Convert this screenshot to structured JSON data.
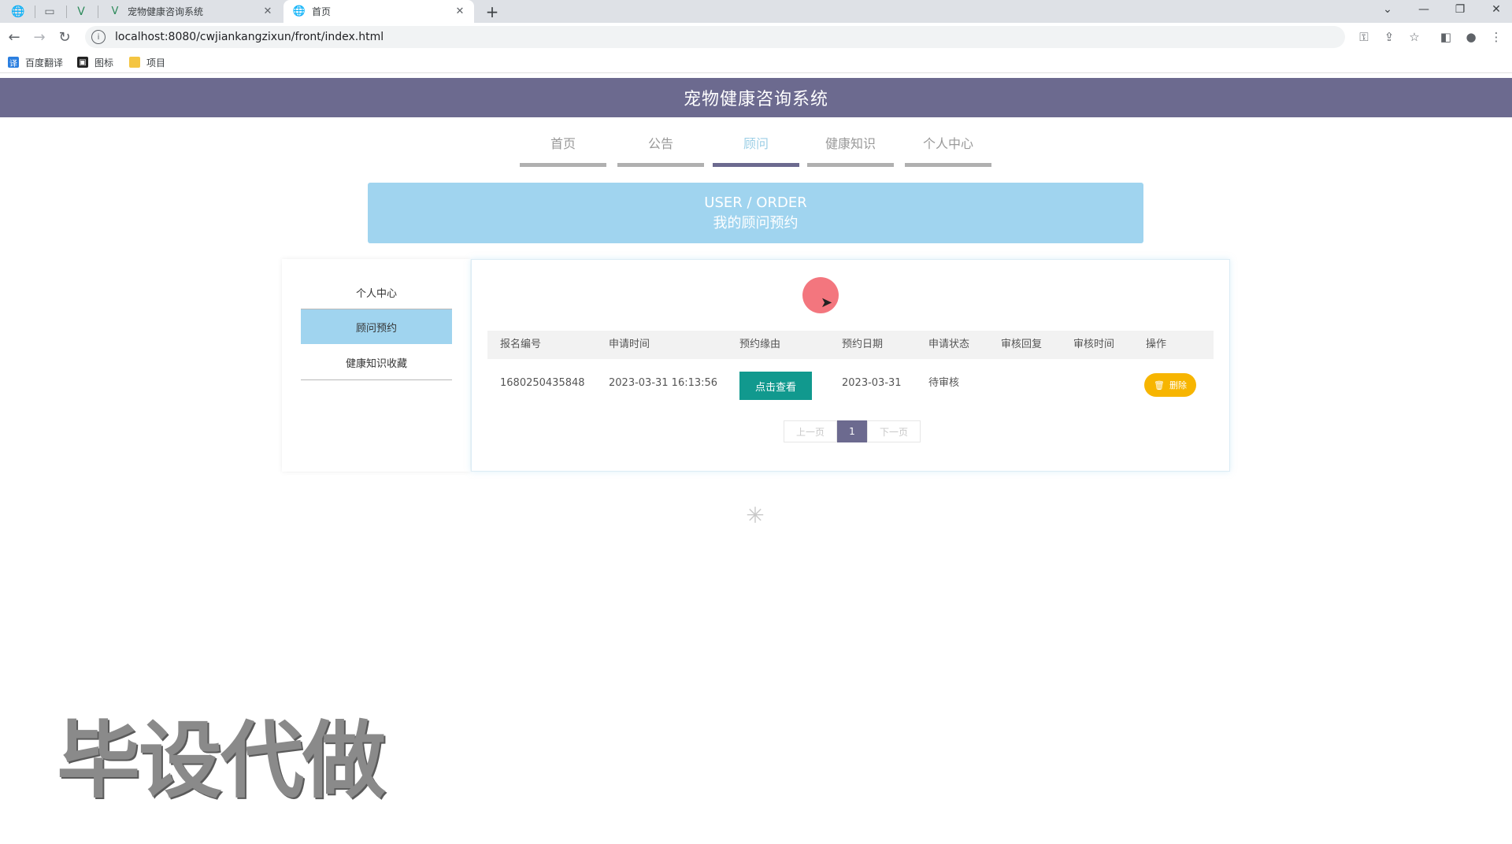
{
  "browser": {
    "tabs": [
      {
        "title": "宠物健康咨询系统",
        "close": "✕"
      },
      {
        "title": "首页",
        "close": "✕"
      }
    ],
    "new_tab": "+",
    "url": "localhost:8080/cwjiankangzixun/front/index.html",
    "bookmarks": [
      "百度翻译",
      "图标",
      "项目"
    ],
    "window_controls": [
      "⌄",
      "—",
      "❐",
      "✕"
    ]
  },
  "site": {
    "title": "宠物健康咨询系统",
    "nav": [
      "首页",
      "公告",
      "顾问",
      "健康知识",
      "个人中心"
    ],
    "nav_active": "顾问"
  },
  "banner": {
    "en": "USER / ORDER",
    "cn": "我的顾问预约"
  },
  "sidebar": {
    "items": [
      "个人中心",
      "顾问预约",
      "健康知识收藏"
    ],
    "active": "顾问预约"
  },
  "table": {
    "headers": [
      "报名编号",
      "申请时间",
      "预约缘由",
      "预约日期",
      "申请状态",
      "审核回复",
      "审核时间",
      "操作"
    ],
    "rows": [
      {
        "id": "1680250435848",
        "apply_time": "2023-03-31 16:13:56",
        "reason_btn": "点击查看",
        "date": "2023-03-31",
        "status": "待审核",
        "reply": "",
        "review_time": "",
        "delete_btn": "删除"
      }
    ]
  },
  "pager": {
    "prev": "上一页",
    "current": "1",
    "next": "下一页"
  },
  "watermark": "毕设代做",
  "colors": {
    "header": "#6c6a8f",
    "banner": "#a0d4ef",
    "view_button": "#11998e",
    "delete_button": "#f7b500"
  }
}
